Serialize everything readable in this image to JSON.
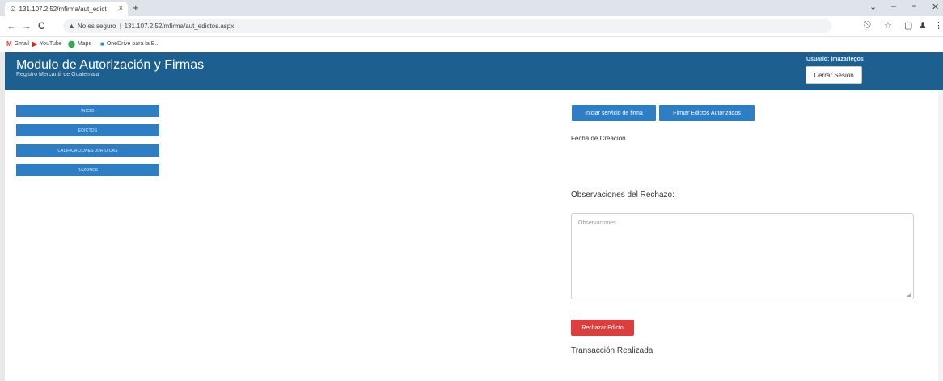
{
  "browser": {
    "tab_title": "131.107.2.52/mfirma/aut_edict",
    "tab_close": "×",
    "new_tab": "+",
    "window_controls": {
      "menu": "⌄",
      "minimize": "–",
      "maximize": "▫",
      "close": "✕"
    },
    "nav": {
      "back": "←",
      "forward": "→",
      "reload": "C"
    },
    "security_text": "No es seguro",
    "url": "131.107.2.52/mfirma/aut_edictos.aspx",
    "bookmarks": [
      {
        "icon": "M",
        "label": "Gmail",
        "color": "#d44638"
      },
      {
        "icon": "▶",
        "label": "YouTube",
        "color": "#e02020"
      },
      {
        "icon": "⬤",
        "label": "Maps",
        "color": "#34a853"
      },
      {
        "icon": "■",
        "label": "OneDrive para la E...",
        "color": "#1e88e5"
      }
    ]
  },
  "header": {
    "title": "Modulo de Autorización y Firmas",
    "subtitle": "Registro Mercantil de Guatemala",
    "user": "Usuario: jmazariegos",
    "logout": "Cerrar Sesión",
    "bg_color": "#1d5f8f"
  },
  "sidebar": {
    "items": [
      {
        "label": "INICIO"
      },
      {
        "label": "EDICTOS"
      },
      {
        "label": "CALIFICACIONES JURIDICAS"
      },
      {
        "label": "RAZONES"
      }
    ]
  },
  "actions": {
    "start_service": "Iniciar servicio de firma",
    "sign_authorized": "Firmar Edictos Autorizados"
  },
  "content": {
    "creation_date_label": "Fecha de Creación",
    "rejection_label": "Observaciones del Rechazo:",
    "observations_placeholder": "Observaciones",
    "reject_button": "Rechazar Edicto",
    "status": "Transacción Realizada",
    "accent_color": "#2d7ec5",
    "reject_color": "#dc3e3e"
  }
}
